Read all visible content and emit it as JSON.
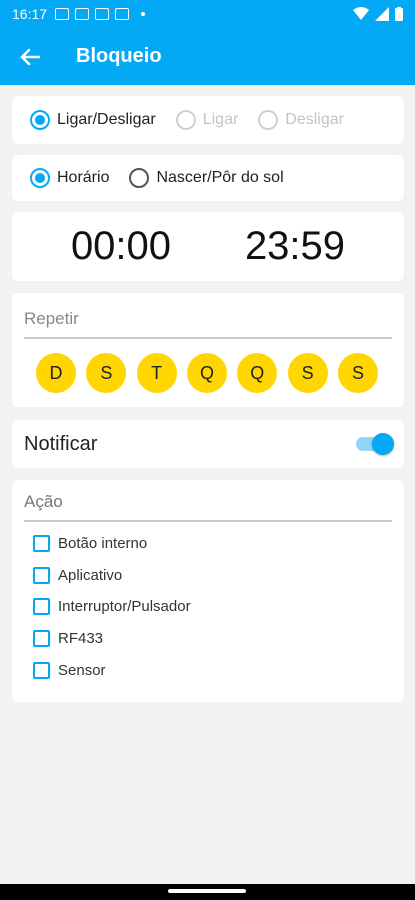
{
  "status_bar": {
    "time": "16:17",
    "icons": [
      "notification-icon",
      "notification-icon",
      "notification-icon",
      "notification-icon"
    ]
  },
  "app_bar": {
    "title": "Bloqueio",
    "back_icon": "arrow-left-icon"
  },
  "mode": {
    "options": [
      {
        "label": "Ligar/Desligar",
        "checked": true,
        "disabled": false
      },
      {
        "label": "Ligar",
        "checked": false,
        "disabled": true
      },
      {
        "label": "Desligar",
        "checked": false,
        "disabled": true
      }
    ]
  },
  "trigger": {
    "options": [
      {
        "label": "Horário",
        "checked": true
      },
      {
        "label": "Nascer/Pôr do sol",
        "checked": false
      }
    ]
  },
  "times": {
    "start": "00:00",
    "end": "23:59"
  },
  "repeat": {
    "label": "Repetir",
    "days": [
      "D",
      "S",
      "T",
      "Q",
      "Q",
      "S",
      "S"
    ]
  },
  "notify": {
    "label": "Notificar",
    "enabled": true
  },
  "action": {
    "label": "Ação",
    "items": [
      "Botão interno",
      "Aplicativo",
      "Interruptor/Pulsador",
      "RF433",
      "Sensor"
    ]
  },
  "colors": {
    "accent": "#03a9f4",
    "day_badge": "#ffd600"
  }
}
